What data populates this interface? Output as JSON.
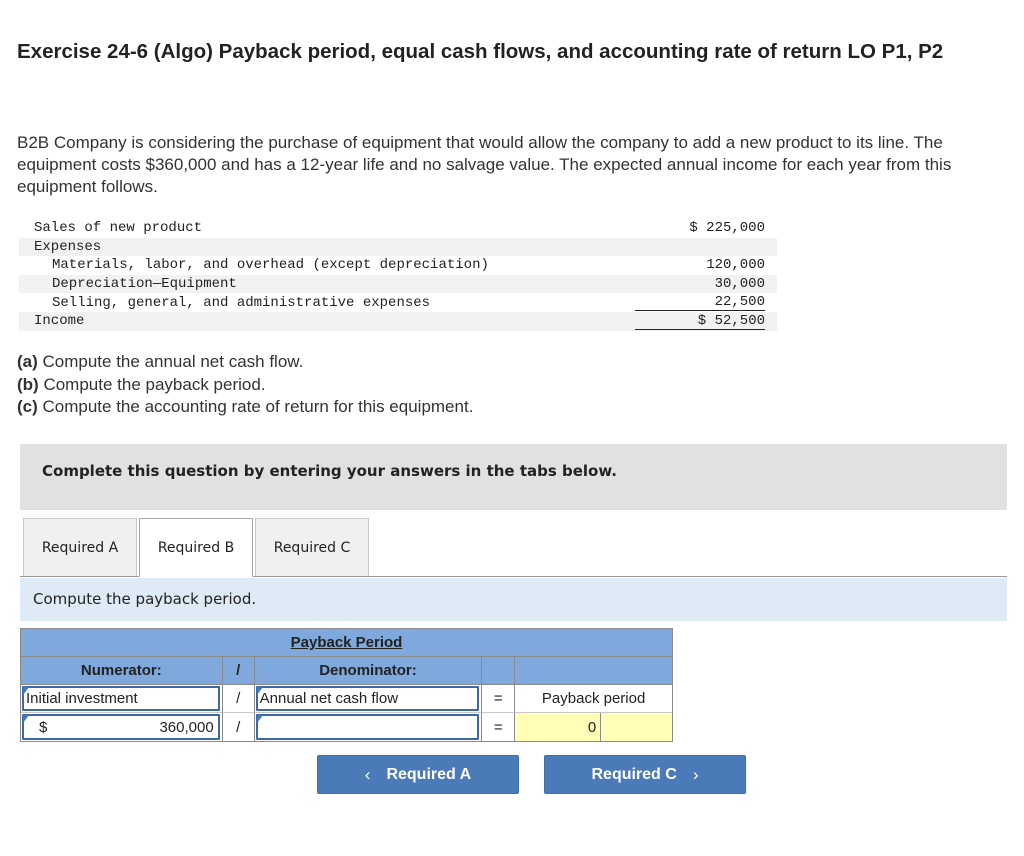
{
  "title": "Exercise 24-6 (Algo) Payback period, equal cash flows, and accounting rate of return LO P1, P2",
  "intro": "B2B Company is considering the purchase of equipment that would allow the company to add a new product to its line. The equipment costs $360,000 and has a 12-year life and no salvage value. The expected annual income for each year from this equipment follows.",
  "income_statement": {
    "rows": [
      {
        "label": "Sales of new product",
        "amount": "$ 225,000"
      },
      {
        "label": "Expenses",
        "amount": ""
      },
      {
        "label": "Materials, labor, and overhead (except depreciation)",
        "amount": "120,000"
      },
      {
        "label": "Depreciation—Equipment",
        "amount": "30,000"
      },
      {
        "label": "Selling, general, and administrative expenses",
        "amount": "22,500"
      },
      {
        "label": "Income",
        "amount": "$ 52,500"
      }
    ]
  },
  "questions": [
    {
      "tag": "(a)",
      "text": " Compute the annual net cash flow."
    },
    {
      "tag": "(b)",
      "text": " Compute the payback period."
    },
    {
      "tag": "(c)",
      "text": " Compute the accounting rate of return for this equipment."
    }
  ],
  "banner": "Complete this question by entering your answers in the tabs below.",
  "tabs": [
    {
      "label": "Required A",
      "active": false
    },
    {
      "label": "Required B",
      "active": true
    },
    {
      "label": "Required C",
      "active": false
    }
  ],
  "instruction": "Compute the payback period.",
  "calc": {
    "title": "Payback Period",
    "numerator_header": "Numerator:",
    "divide_symbol": "/",
    "denominator_header": "Denominator:",
    "equals_symbol": "=",
    "numerator_label": "Initial investment",
    "denominator_label": "Annual net cash flow",
    "result_label": "Payback period",
    "numerator_currency": "$",
    "numerator_value": "360,000",
    "denominator_value": "",
    "result_value": "0",
    "result_unit": ""
  },
  "nav": {
    "prev_label": "Required A",
    "prev_icon": "‹",
    "next_label": "Required C",
    "next_icon": "›"
  }
}
